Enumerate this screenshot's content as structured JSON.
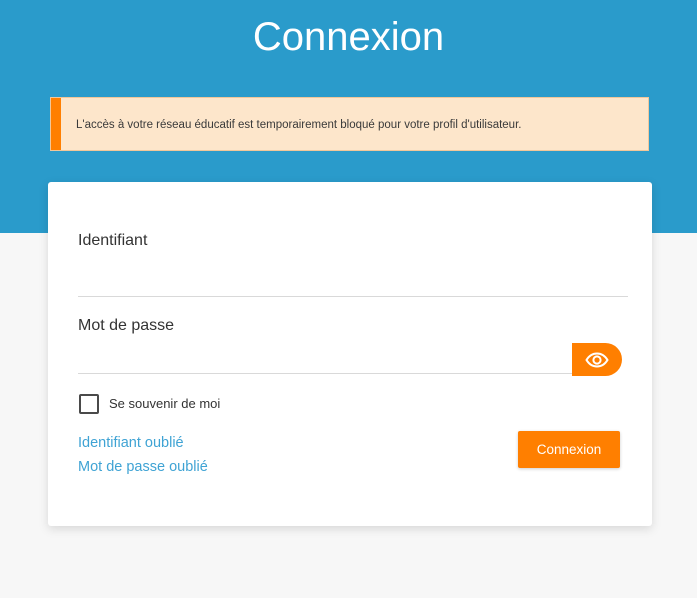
{
  "page": {
    "title": "Connexion"
  },
  "alert": {
    "message": "L'accès à votre réseau éducatif est temporairement bloqué pour votre profil d'utilisateur.",
    "accent_color": "#ff7f00",
    "background_color": "#fde6cb"
  },
  "form": {
    "username_label": "Identifiant",
    "username_value": "",
    "password_label": "Mot de passe",
    "password_value": "",
    "show_password_icon": "eye-icon",
    "remember_label": "Se souvenir de moi",
    "remember_checked": false,
    "forgot_username_link": "Identifiant oublié",
    "forgot_password_link": "Mot de passe oublié",
    "submit_label": "Connexion"
  },
  "colors": {
    "header_blue": "#2a9bcb",
    "accent_orange": "#ff7f00",
    "link_blue": "#3fa3d4"
  }
}
